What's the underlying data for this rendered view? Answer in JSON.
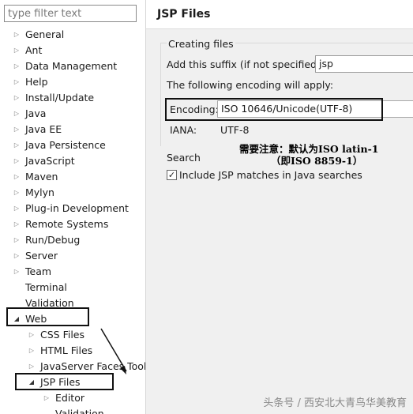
{
  "filter": {
    "placeholder": "type filter text"
  },
  "tree": {
    "items": [
      {
        "label": "General",
        "level": 0,
        "state": "collapsed"
      },
      {
        "label": "Ant",
        "level": 0,
        "state": "collapsed"
      },
      {
        "label": "Data Management",
        "level": 0,
        "state": "collapsed"
      },
      {
        "label": "Help",
        "level": 0,
        "state": "collapsed"
      },
      {
        "label": "Install/Update",
        "level": 0,
        "state": "collapsed"
      },
      {
        "label": "Java",
        "level": 0,
        "state": "collapsed"
      },
      {
        "label": "Java EE",
        "level": 0,
        "state": "collapsed"
      },
      {
        "label": "Java Persistence",
        "level": 0,
        "state": "collapsed"
      },
      {
        "label": "JavaScript",
        "level": 0,
        "state": "collapsed"
      },
      {
        "label": "Maven",
        "level": 0,
        "state": "collapsed"
      },
      {
        "label": "Mylyn",
        "level": 0,
        "state": "collapsed"
      },
      {
        "label": "Plug-in Development",
        "level": 0,
        "state": "collapsed"
      },
      {
        "label": "Remote Systems",
        "level": 0,
        "state": "collapsed"
      },
      {
        "label": "Run/Debug",
        "level": 0,
        "state": "collapsed"
      },
      {
        "label": "Server",
        "level": 0,
        "state": "collapsed"
      },
      {
        "label": "Team",
        "level": 0,
        "state": "collapsed"
      },
      {
        "label": "Terminal",
        "level": 0,
        "state": "leaf"
      },
      {
        "label": "Validation",
        "level": 0,
        "state": "leaf"
      },
      {
        "label": "Web",
        "level": 0,
        "state": "expanded"
      },
      {
        "label": "CSS Files",
        "level": 1,
        "state": "collapsed"
      },
      {
        "label": "HTML Files",
        "level": 1,
        "state": "collapsed"
      },
      {
        "label": "JavaServer Faces Tools",
        "level": 1,
        "state": "collapsed"
      },
      {
        "label": "JSP Files",
        "level": 1,
        "state": "expanded"
      },
      {
        "label": "Editor",
        "level": 2,
        "state": "collapsed"
      },
      {
        "label": "Validation",
        "level": 2,
        "state": "leaf"
      }
    ]
  },
  "page": {
    "title": "JSP Files",
    "creating_files": "Creating files",
    "suffix_label": "Add this suffix (if not specified):",
    "suffix_value": "jsp",
    "encoding_note": "The following encoding will apply:",
    "encoding_label": "Encoding:",
    "encoding_value": "ISO 10646/Unicode(UTF-8)",
    "iana_label": "IANA:",
    "iana_value": "UTF-8",
    "search_label": "Search",
    "include_label": "Include JSP matches in Java searches",
    "include_checked": true
  },
  "annotation": {
    "line1": "需要注意：默认为ISO latin-1",
    "line2": "（即ISO 8859-1）"
  },
  "watermark": "头条号 / 西安北大青鸟华美教育"
}
